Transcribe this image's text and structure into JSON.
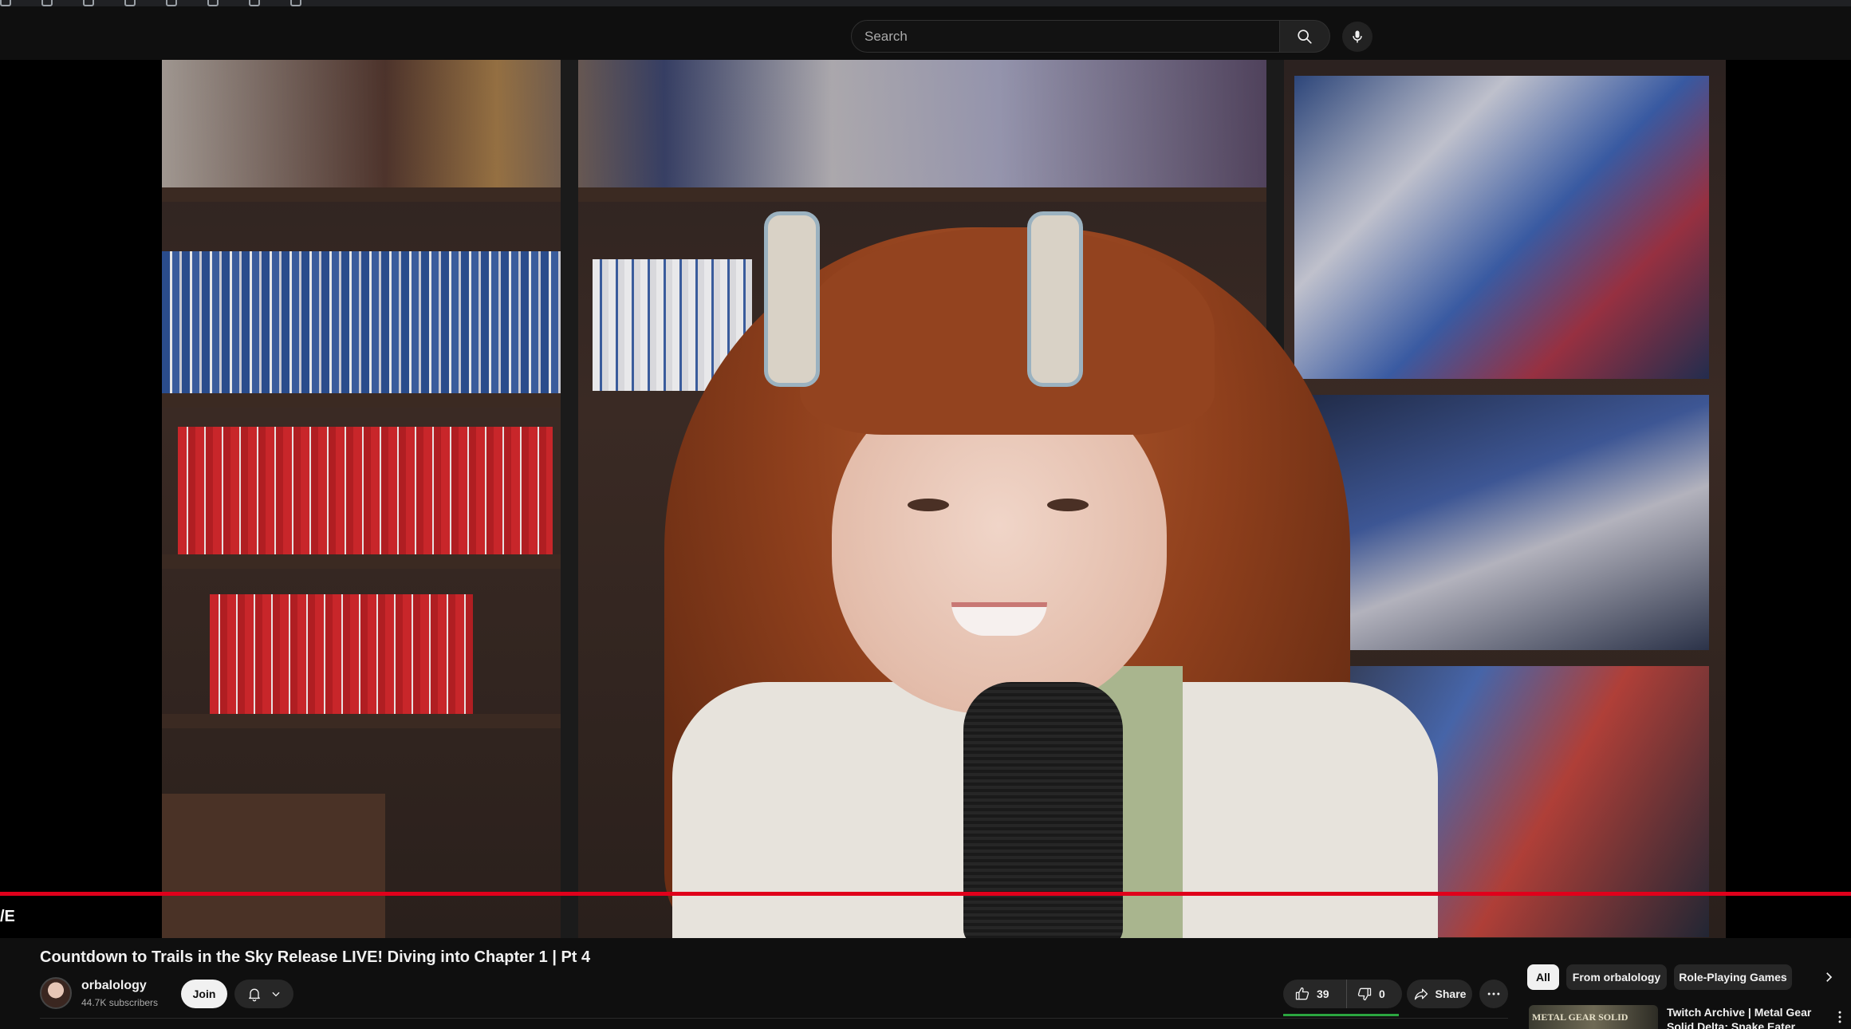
{
  "search": {
    "placeholder": "Search"
  },
  "player": {
    "live_label": "/E"
  },
  "video": {
    "title": "Countdown to Trails in the Sky Release LIVE! Diving into Chapter 1 | Pt 4",
    "channel_name": "orbalology",
    "subscribers": "44.7K subscribers",
    "join_label": "Join",
    "likes": "39",
    "dislikes": "0",
    "like_ratio": 1.0,
    "share_label": "Share"
  },
  "chips": {
    "all": "All",
    "from_channel": "From orbalology",
    "rpg": "Role-Playing Games"
  },
  "related": [
    {
      "title": "Twitch Archive | Metal Gear Solid Delta: Snake Eater [FULL",
      "thumb_text": "METAL GEAR SOLID"
    }
  ],
  "colors": {
    "background": "#0f0f0f",
    "progress": "#e0001b",
    "like_bar": "#2ba640",
    "chip_active": "#f1f1f1",
    "chip": "#272727"
  }
}
